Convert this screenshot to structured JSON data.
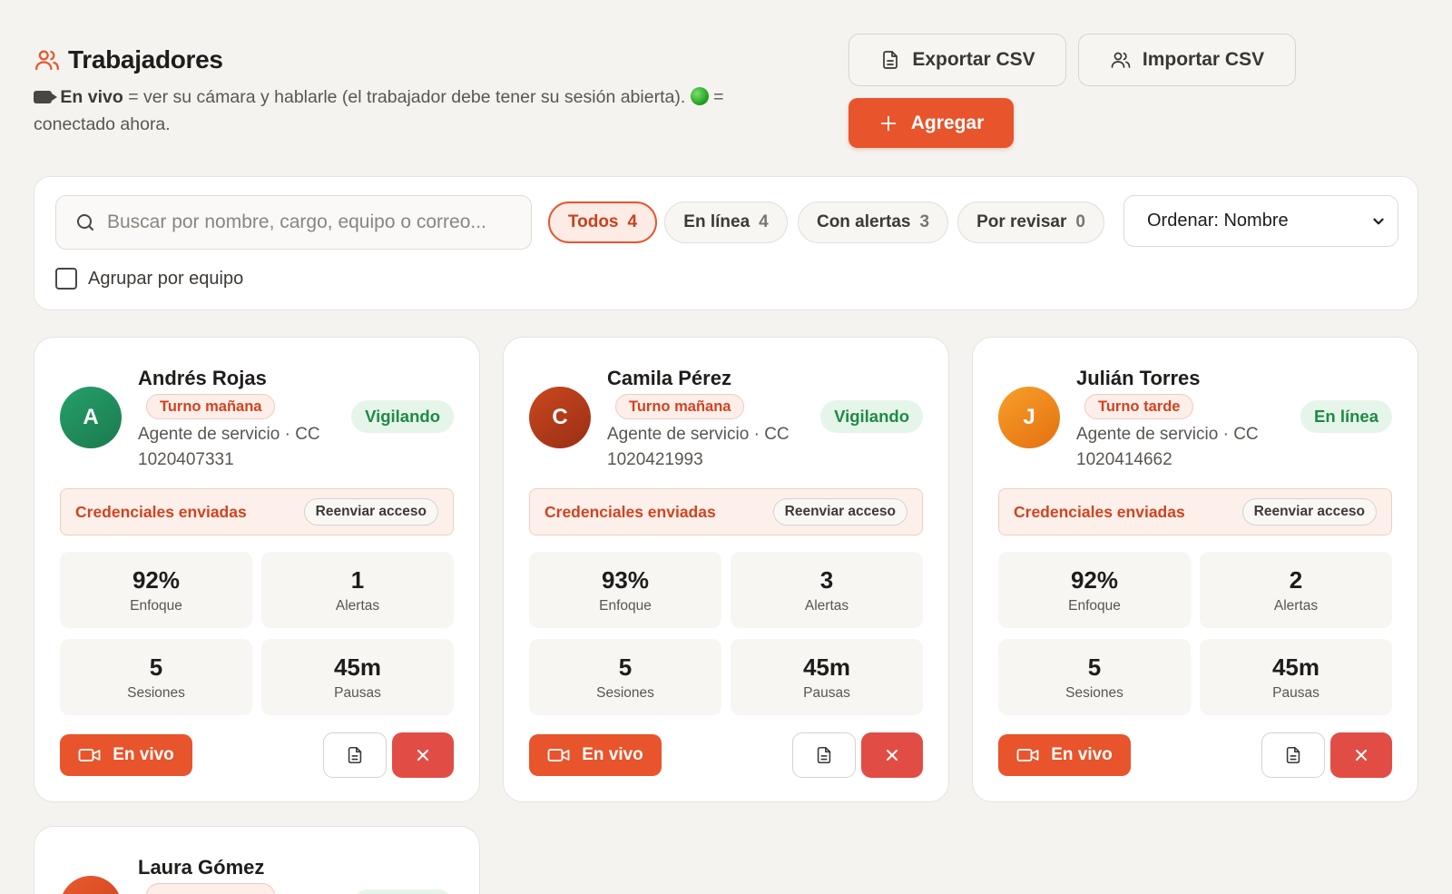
{
  "header": {
    "title": "Trabajadores",
    "subtitle_bold": "En vivo",
    "subtitle_mid": " = ver su cámara y hablarle (el trabajador debe tener su sesión abierta). ",
    "subtitle_end": " = conectado ahora.",
    "export_label": "Exportar CSV",
    "import_label": "Importar CSV",
    "add_label": "Agregar"
  },
  "filters": {
    "search_placeholder": "Buscar por nombre, cargo, equipo o correo...",
    "chips": [
      {
        "label": "Todos",
        "count": "4"
      },
      {
        "label": "En línea",
        "count": "4"
      },
      {
        "label": "Con alertas",
        "count": "3"
      },
      {
        "label": "Por revisar",
        "count": "0"
      }
    ],
    "sort_label": "Ordenar: Nombre",
    "group_label": "Agrupar por equipo"
  },
  "labels": {
    "cred_label": "Credenciales enviadas",
    "cred_btn": "Reenviar acceso",
    "focus": "Enfoque",
    "alerts": "Alertas",
    "sessions": "Sesiones",
    "breaks": "Pausas",
    "live": "En vivo"
  },
  "workers": [
    {
      "initial": "A",
      "name": "Andrés Rojas",
      "shift": "Turno mañana",
      "role": "Agente de servicio · CC 1020407331",
      "status": "Vigilando",
      "focus": "92%",
      "alerts": "1",
      "sessions": "5",
      "breaks": "45m"
    },
    {
      "initial": "C",
      "name": "Camila Pérez",
      "shift": "Turno mañana",
      "role": "Agente de servicio · CC 1020421993",
      "status": "Vigilando",
      "focus": "93%",
      "alerts": "3",
      "sessions": "5",
      "breaks": "45m"
    },
    {
      "initial": "J",
      "name": "Julián Torres",
      "shift": "Turno tarde",
      "role": "Agente de servicio · CC 1020414662",
      "status": "En línea",
      "focus": "92%",
      "alerts": "2",
      "sessions": "5",
      "breaks": "45m"
    },
    {
      "name": "Laura Gómez"
    }
  ],
  "colors": {
    "accent": "#e8542b",
    "avatar_a": "#1f8a5b",
    "avatar_c": "#b8391c",
    "avatar_j": "#f08a1c",
    "danger": "#e14d45",
    "status_green": "#1e8a45"
  }
}
